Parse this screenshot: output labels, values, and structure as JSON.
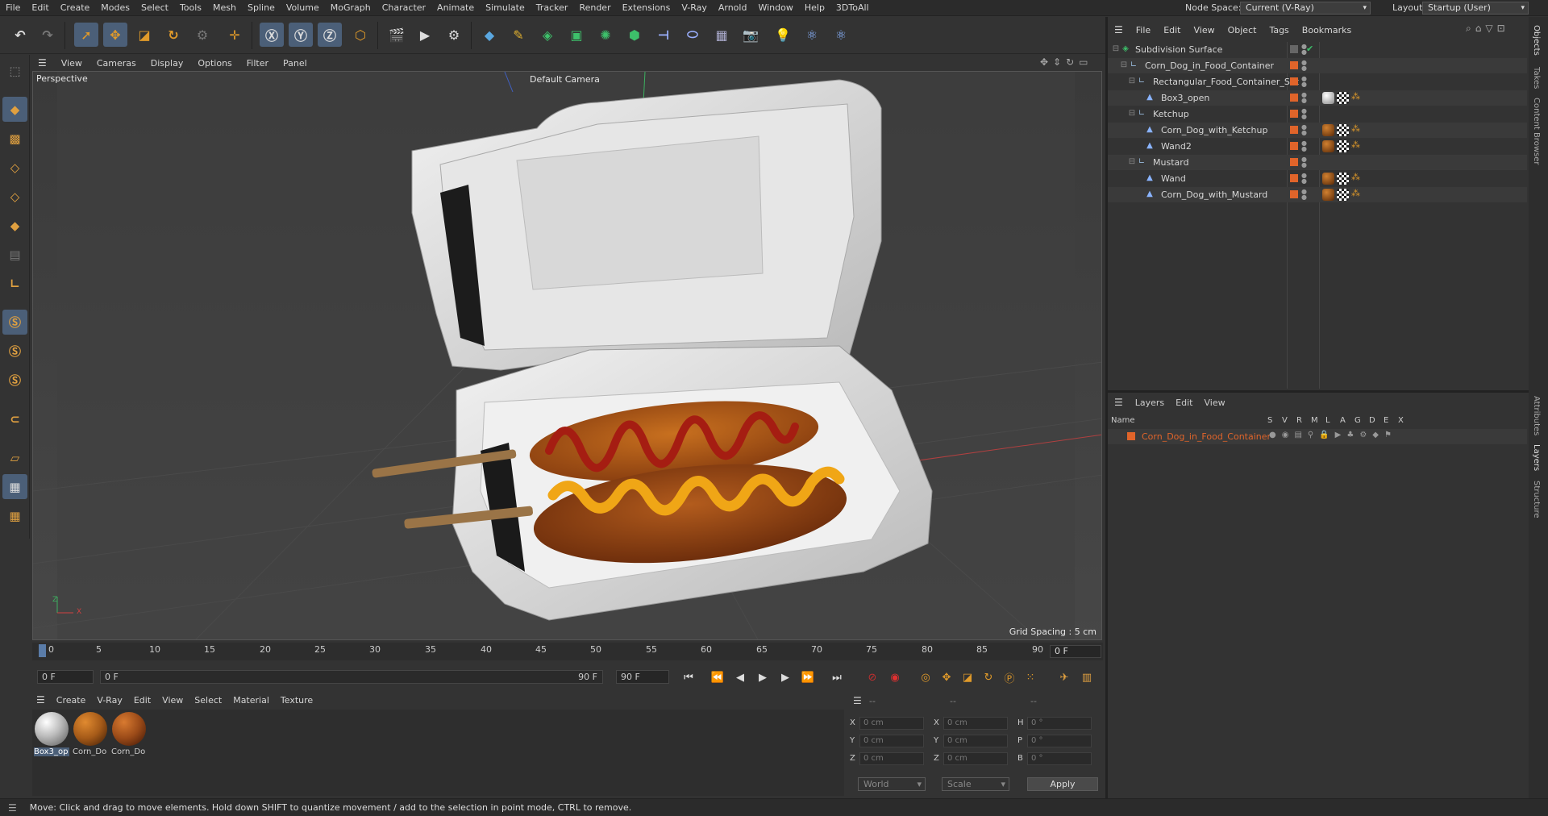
{
  "menubar": {
    "items": [
      "File",
      "Edit",
      "Create",
      "Modes",
      "Select",
      "Tools",
      "Mesh",
      "Spline",
      "Volume",
      "MoGraph",
      "Character",
      "Animate",
      "Simulate",
      "Tracker",
      "Render",
      "Extensions",
      "V-Ray",
      "Arnold",
      "Window",
      "Help",
      "3DToAll"
    ],
    "node_space_label": "Node Space:",
    "node_space_value": "Current (V-Ray)",
    "layout_label": "Layout:",
    "layout_value": "Startup (User)"
  },
  "viewport": {
    "menu": [
      "View",
      "Cameras",
      "Display",
      "Options",
      "Filter",
      "Panel"
    ],
    "label": "Perspective",
    "camera": "Default Camera",
    "grid_spacing": "Grid Spacing : 5 cm",
    "axis_x": "X",
    "axis_z": "Z"
  },
  "timeline": {
    "ticks": [
      "0",
      "5",
      "10",
      "15",
      "20",
      "25",
      "30",
      "35",
      "40",
      "45",
      "50",
      "55",
      "60",
      "65",
      "70",
      "75",
      "80",
      "85",
      "90"
    ],
    "current_frame": "0 F",
    "start_field": "0 F",
    "range_start": "0 F",
    "range_end": "90 F",
    "end_field": "90 F"
  },
  "materials": {
    "menu": [
      "Create",
      "V-Ray",
      "Edit",
      "View",
      "Select",
      "Material",
      "Texture"
    ],
    "items": [
      {
        "label": "Box3_op",
        "color": "#d9d9d9"
      },
      {
        "label": "Corn_Do",
        "color": "#b06418"
      },
      {
        "label": "Corn_Do",
        "color": "#a8521c"
      }
    ]
  },
  "coordinates": {
    "head": [
      "--",
      "--",
      "--"
    ],
    "rows": [
      {
        "l1": "X",
        "v1": "0 cm",
        "l2": "X",
        "v2": "0 cm",
        "l3": "H",
        "v3": "0 °"
      },
      {
        "l1": "Y",
        "v1": "0 cm",
        "l2": "Y",
        "v2": "0 cm",
        "l3": "P",
        "v3": "0 °"
      },
      {
        "l1": "Z",
        "v1": "0 cm",
        "l2": "Z",
        "v2": "0 cm",
        "l3": "B",
        "v3": "0 °"
      }
    ],
    "world": "World",
    "scale": "Scale",
    "apply": "Apply"
  },
  "objects": {
    "menu": [
      "File",
      "Edit",
      "View",
      "Object",
      "Tags",
      "Bookmarks"
    ],
    "tree": [
      {
        "name": "Subdivision Surface",
        "level": 0
      },
      {
        "name": "Corn_Dog_in_Food_Container",
        "level": 1
      },
      {
        "name": "Rectangular_Food_Container_Set",
        "level": 2
      },
      {
        "name": "Box3_open",
        "level": 3
      },
      {
        "name": "Ketchup",
        "level": 2
      },
      {
        "name": "Corn_Dog_with_Ketchup",
        "level": 3
      },
      {
        "name": "Wand2",
        "level": 3
      },
      {
        "name": "Mustard",
        "level": 2
      },
      {
        "name": "Wand",
        "level": 3
      },
      {
        "name": "Corn_Dog_with_Mustard",
        "level": 3
      }
    ]
  },
  "layers": {
    "menu": [
      "Layers",
      "Edit",
      "View"
    ],
    "columns": [
      "Name",
      "S",
      "V",
      "R",
      "M",
      "L",
      "A",
      "G",
      "D",
      "E",
      "X"
    ],
    "row_name": "Corn_Dog_in_Food_Container"
  },
  "side_tabs": [
    "Objects",
    "Takes",
    "Content Browser",
    "Attributes",
    "Layers",
    "Structure"
  ],
  "status": "Move: Click and drag to move elements. Hold down SHIFT to quantize movement / add to the selection in point mode, CTRL to remove.",
  "colors": {
    "accent_orange": "#e0642a",
    "active_tool": "#4b5f78",
    "ketchup": "#a51d12",
    "mustard": "#f0a616",
    "corndog": "#a5551c"
  }
}
